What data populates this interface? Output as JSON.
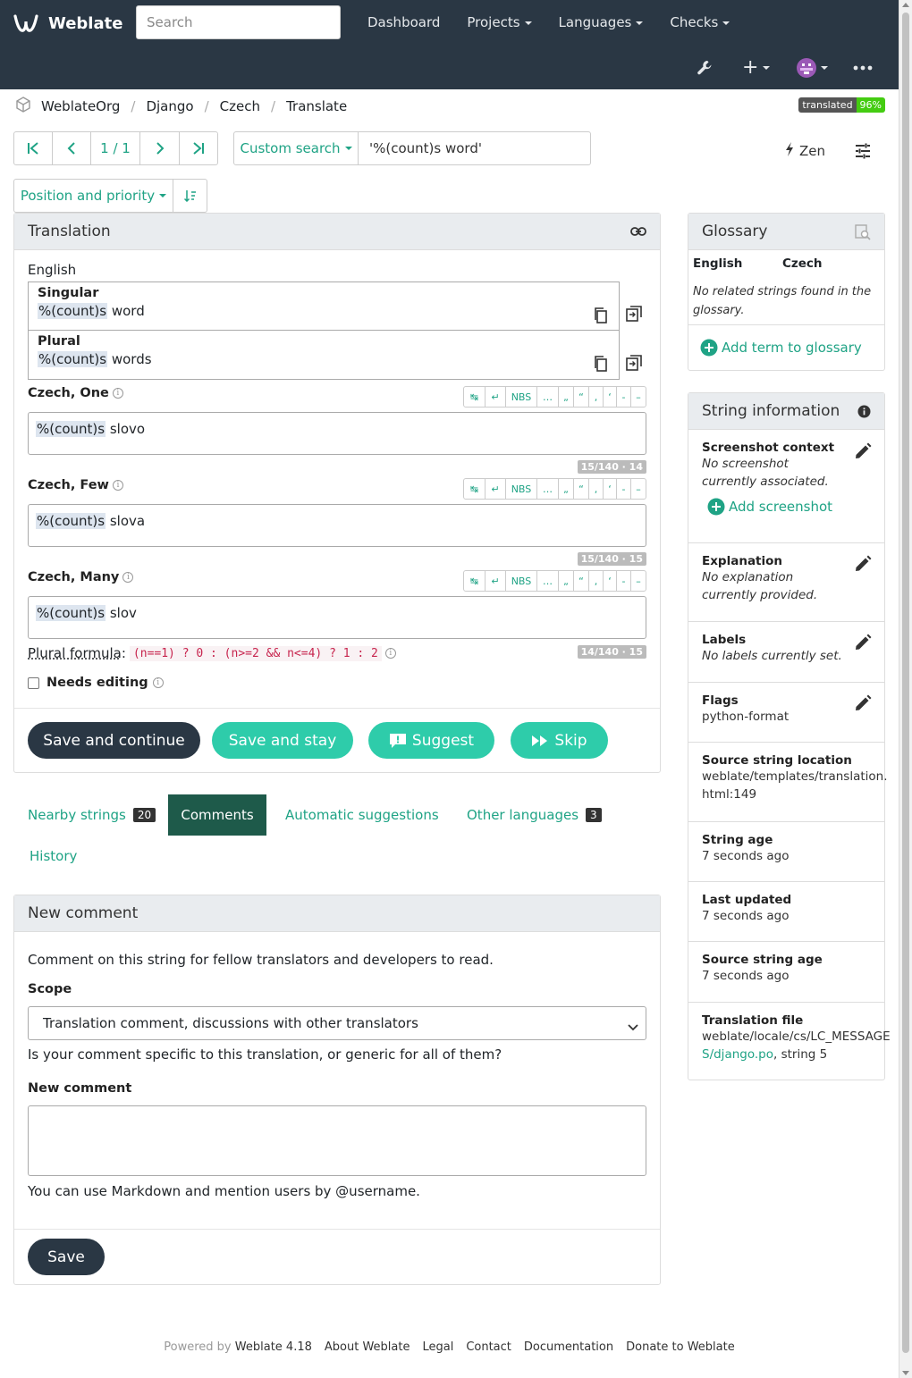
{
  "nav": {
    "brand": "Weblate",
    "search_placeholder": "Search",
    "items": [
      "Dashboard",
      "Projects",
      "Languages",
      "Checks"
    ],
    "icons": [
      "wrench-icon",
      "plus-icon",
      "avatar",
      "more-icon"
    ]
  },
  "breadcrumb": [
    "WeblateOrg",
    "Django",
    "Czech",
    "Translate"
  ],
  "badge": {
    "label": "translated",
    "value": "96%"
  },
  "pager": {
    "position": "1 / 1"
  },
  "search": {
    "scope": "Custom search",
    "query": "'%(count)s word'"
  },
  "zen_label": "Zen",
  "sort_label": "Position and priority",
  "translation": {
    "title": "Translation",
    "source_lang": "English",
    "singular_label": "Singular",
    "singular_placeholder": "%(count)s",
    "singular_text": " word",
    "plural_label": "Plural",
    "plural_placeholder": "%(count)s",
    "plural_text": " words",
    "forms": [
      {
        "label": "Czech, One",
        "placeholder": "%(count)s",
        "text": " slovo",
        "counter": "15/140 · 14"
      },
      {
        "label": "Czech, Few",
        "placeholder": "%(count)s",
        "text": " slova",
        "counter": "15/140 · 15"
      },
      {
        "label": "Czech, Many",
        "placeholder": "%(count)s",
        "text": " slov",
        "counter": "14/140 · 15"
      }
    ],
    "tools": [
      "↹",
      "↵",
      "NBS",
      "…",
      "„",
      "“",
      ",",
      "‘",
      "-",
      "–"
    ],
    "plural_formula_label": "Plural formula",
    "plural_formula": "(n==1) ? 0 : (n>=2 && n<=4) ? 1 : 2",
    "needs_editing": "Needs editing",
    "buttons": {
      "save_continue": "Save and continue",
      "save_stay": "Save and stay",
      "suggest": "Suggest",
      "skip": "Skip"
    }
  },
  "tabs": {
    "nearby": "Nearby strings",
    "nearby_count": "20",
    "comments": "Comments",
    "auto": "Automatic suggestions",
    "other": "Other languages",
    "other_count": "3",
    "history": "History"
  },
  "comment": {
    "title": "New comment",
    "intro": "Comment on this string for fellow translators and developers to read.",
    "scope_label": "Scope",
    "scope_value": "Translation comment, discussions with other translators",
    "scope_help": "Is your comment specific to this translation, or generic for all of them?",
    "new_label": "New comment",
    "markdown_help": "You can use Markdown and mention users by @username.",
    "save": "Save"
  },
  "glossary": {
    "title": "Glossary",
    "col1": "English",
    "col2": "Czech",
    "empty": "No related strings found in the glossary.",
    "add": "Add term to glossary"
  },
  "info": {
    "title": "String information",
    "screenshot_label": "Screenshot context",
    "screenshot_value": "No screenshot currently associated.",
    "add_screenshot": "Add screenshot",
    "explanation_label": "Explanation",
    "explanation_value": "No explanation currently provided.",
    "labels_label": "Labels",
    "labels_value": "No labels currently set.",
    "flags_label": "Flags",
    "flags_value": "python-format",
    "location_label": "Source string location",
    "location_value_1": "weblate/templates/translation.",
    "location_value_2": "html:149",
    "age_label": "String age",
    "age_value": "7 seconds ago",
    "updated_label": "Last updated",
    "updated_value": "7 seconds ago",
    "source_age_label": "Source string age",
    "source_age_value": "7 seconds ago",
    "file_label": "Translation file",
    "file_value_1": "weblate/locale/cs/LC_MESSAGE",
    "file_value_2": "S/django.po",
    "file_suffix": ", string 5"
  },
  "footer": {
    "powered": "Powered by",
    "version": "Weblate 4.18",
    "links": [
      "About Weblate",
      "Legal",
      "Contact",
      "Documentation",
      "Donate to Weblate"
    ]
  },
  "colors": {
    "navbar": "#2a3744",
    "accent": "#1fa385",
    "button_teal": "#2eccaa",
    "tab_active": "#1e5a4a"
  }
}
